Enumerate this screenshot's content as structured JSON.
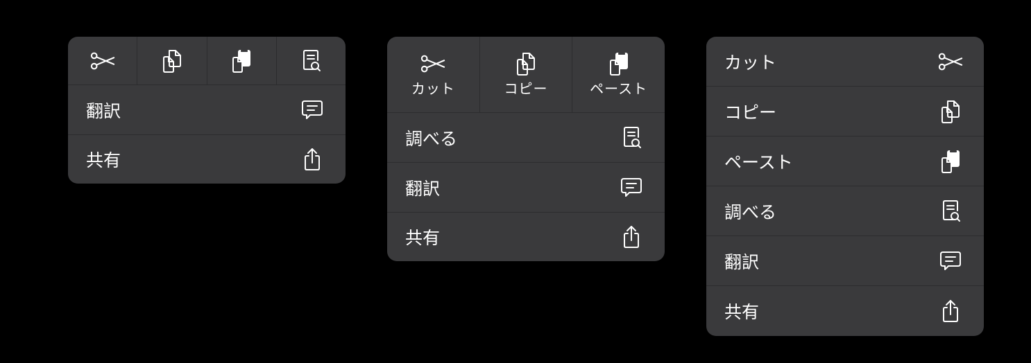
{
  "colors": {
    "background": "#000000",
    "menu_background": "#3a3a3c",
    "separator": "#2c2c2e",
    "text": "#ffffff"
  },
  "menu_compact": {
    "icon_buttons": [
      {
        "icon": "scissors-icon"
      },
      {
        "icon": "copy-icon"
      },
      {
        "icon": "paste-icon"
      },
      {
        "icon": "look-up-icon"
      }
    ],
    "rows": [
      {
        "label": "翻訳",
        "icon": "translate-icon"
      },
      {
        "label": "共有",
        "icon": "share-icon"
      }
    ]
  },
  "menu_medium": {
    "icon_buttons": [
      {
        "label": "カット",
        "icon": "scissors-icon"
      },
      {
        "label": "コピー",
        "icon": "copy-icon"
      },
      {
        "label": "ペースト",
        "icon": "paste-icon"
      }
    ],
    "rows": [
      {
        "label": "調べる",
        "icon": "look-up-icon"
      },
      {
        "label": "翻訳",
        "icon": "translate-icon"
      },
      {
        "label": "共有",
        "icon": "share-icon"
      }
    ]
  },
  "menu_full": {
    "rows": [
      {
        "label": "カット",
        "icon": "scissors-icon"
      },
      {
        "label": "コピー",
        "icon": "copy-icon"
      },
      {
        "label": "ペースト",
        "icon": "paste-icon"
      },
      {
        "label": "調べる",
        "icon": "look-up-icon"
      },
      {
        "label": "翻訳",
        "icon": "translate-icon"
      },
      {
        "label": "共有",
        "icon": "share-icon"
      }
    ]
  }
}
